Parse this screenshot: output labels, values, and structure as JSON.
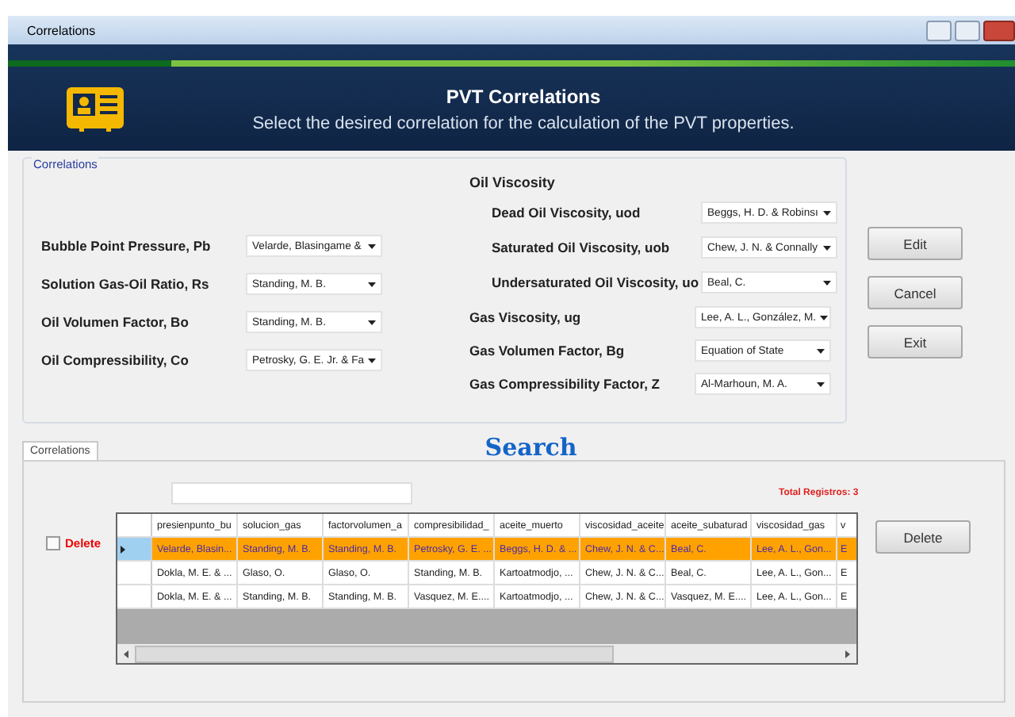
{
  "window": {
    "title": "Correlations"
  },
  "header": {
    "title": "PVT Correlations",
    "subtitle": "Select the desired correlation for the calculation of the PVT properties."
  },
  "correlations_group": {
    "title": "Correlations",
    "left": [
      {
        "label": "Bubble Point Pressure, Pb",
        "value": "Velarde, Blasingame &"
      },
      {
        "label": "Solution Gas-Oil Ratio, Rs",
        "value": "Standing, M. B."
      },
      {
        "label": "Oil Volumen Factor, Bo",
        "value": "Standing, M. B."
      },
      {
        "label": "Oil Compressibility, Co",
        "value": "Petrosky, G. E. Jr. & Fa"
      }
    ],
    "oil_viscosity": {
      "title": "Oil Viscosity",
      "items": [
        {
          "label": "Dead Oil Viscosity, uod",
          "value": "Beggs, H. D. & Robinsı"
        },
        {
          "label": "Saturated Oil Viscosity, uob",
          "value": "Chew, J. N. & Connally"
        },
        {
          "label": "Undersaturated Oil Viscosity, uo",
          "value": "Beal, C."
        }
      ]
    },
    "gas": [
      {
        "label": "Gas Viscosity, ug",
        "value": "Lee, A. L., González, M."
      },
      {
        "label": "Gas Volumen Factor, Bg",
        "value": "Equation of State"
      },
      {
        "label": "Gas Compressibility Factor, Z",
        "value": "Al-Marhoun, M. A."
      }
    ]
  },
  "buttons": [
    "Edit",
    "Cancel",
    "Exit"
  ],
  "search_title": "Search",
  "tabs": [
    {
      "label": "Correlations",
      "selected": true
    }
  ],
  "delete_checkbox": {
    "label": "Delete",
    "checked": false
  },
  "total": "Total Registros: 3",
  "table": {
    "columns": [
      "presienpunto_bu",
      "solucion_gas",
      "factorvolumen_a",
      "compresibilidad_",
      "aceite_muerto",
      "viscosidad_aceite",
      "aceite_subaturad",
      "viscosidad_gas",
      "v"
    ],
    "rows": [
      {
        "selected": true,
        "cells": [
          "Velarde, Blasin...",
          "Standing, M. B.",
          "Standing, M. B.",
          "Petrosky, G. E. ...",
          "Beggs, H. D. & ...",
          "Chew, J. N. & C...",
          "Beal, C.",
          "Lee, A. L., Gon...",
          "E"
        ]
      },
      {
        "selected": false,
        "cells": [
          "Dokla, M. E. & ...",
          "Glaso, O.",
          "Glaso, O.",
          "Standing, M. B.",
          "Kartoatmodjo, ...",
          "Chew, J. N. & C...",
          "Beal, C.",
          "Lee, A. L., Gon...",
          "E"
        ]
      },
      {
        "selected": false,
        "cells": [
          "Dokla, M. E. & ...",
          "Standing, M. B.",
          "Standing, M. B.",
          "Vasquez, M. E....",
          "Kartoatmodjo, ...",
          "Chew, J. N. & C...",
          "Vasquez, M. E....",
          "Lee, A. L., Gon...",
          "E"
        ]
      }
    ]
  },
  "delete_button": "Delete"
}
